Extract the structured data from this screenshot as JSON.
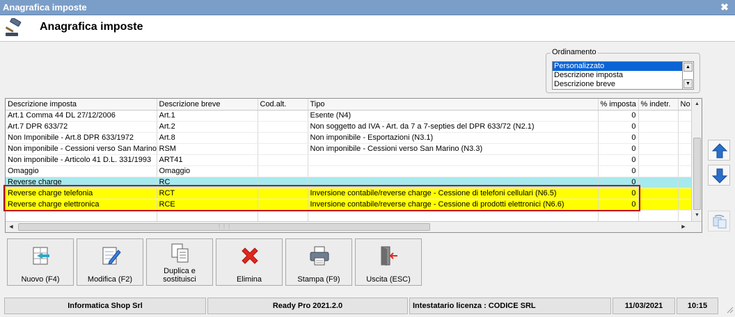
{
  "window": {
    "title": "Anagrafica imposte",
    "close_glyph": "✖"
  },
  "header": {
    "title": "Anagrafica imposte",
    "icon": "gavel-icon"
  },
  "ordinamento": {
    "label": "Ordinamento",
    "options": [
      "Personalizzato",
      "Descrizione imposta",
      "Descrizione breve"
    ],
    "selected": "Personalizzato"
  },
  "grid": {
    "columns": [
      "Descrizione imposta",
      "Descrizione breve",
      "Cod.alt.",
      "Tipo",
      "% imposta",
      "% indetr.",
      "No"
    ],
    "rows": [
      {
        "descrizione": "Art.1 Comma 44 DL 27/12/2006",
        "breve": "Art.1",
        "codalt": "",
        "tipo": "Esente (N4)",
        "imposta": "0",
        "indetr": ""
      },
      {
        "descrizione": "Art.7 DPR 633/72",
        "breve": "Art.2",
        "codalt": "",
        "tipo": "Non soggetto ad IVA - Art. da 7 a 7-septies del DPR 633/72 (N2.1)",
        "imposta": "0",
        "indetr": ""
      },
      {
        "descrizione": "Non Imponibile - Art.8 DPR 633/1972",
        "breve": "Art.8",
        "codalt": "",
        "tipo": "Non imponibile - Esportazioni (N3.1)",
        "imposta": "0",
        "indetr": ""
      },
      {
        "descrizione": "Non imponibile - Cessioni verso San Marino",
        "breve": "RSM",
        "codalt": "",
        "tipo": "Non imponibile - Cessioni verso San Marino (N3.3)",
        "imposta": "0",
        "indetr": ""
      },
      {
        "descrizione": "Non imponibile - Articolo 41 D.L. 331/1993",
        "breve": "ART41",
        "codalt": "",
        "tipo": "",
        "imposta": "0",
        "indetr": ""
      },
      {
        "descrizione": "Omaggio",
        "breve": "Omaggio",
        "codalt": "",
        "tipo": "",
        "imposta": "0",
        "indetr": ""
      },
      {
        "descrizione": "Reverse charge",
        "breve": "RC",
        "codalt": "",
        "tipo": "",
        "imposta": "0",
        "indetr": ""
      },
      {
        "descrizione": "Reverse charge telefonia",
        "breve": "RCT",
        "codalt": "",
        "tipo": "Inversione contabile/reverse charge - Cessione di telefoni cellulari (N6.5)",
        "imposta": "0",
        "indetr": ""
      },
      {
        "descrizione": "Reverse charge elettronica",
        "breve": "RCE",
        "codalt": "",
        "tipo": "Inversione contabile/reverse charge - Cessione di prodotti elettronici (N6.6)",
        "imposta": "0",
        "indetr": ""
      },
      {
        "descrizione": "",
        "breve": "",
        "codalt": "",
        "tipo": "",
        "imposta": "",
        "indetr": ""
      }
    ],
    "row_highlight": {
      "6": "#a6eaee",
      "7": "#ffff00",
      "8": "#ffff00"
    }
  },
  "side_buttons": [
    {
      "name": "move-up-button",
      "icon": "arrow-up-icon"
    },
    {
      "name": "move-down-button",
      "icon": "arrow-down-icon"
    },
    {
      "name": "refresh-button",
      "icon": "refresh-icon"
    }
  ],
  "toolbar": {
    "nuovo": "Nuovo (F4)",
    "modifica": "Modifica (F2)",
    "duplica_line1": "Duplica e",
    "duplica_line2": "sostituisci",
    "elimina": "Elimina",
    "stampa": "Stampa (F9)",
    "uscita": "Uscita (ESC)"
  },
  "status": {
    "company": "Informatica Shop Srl",
    "version": "Ready Pro 2021.2.0",
    "license": "Intestatario licenza : CODICE SRL",
    "date": "11/03/2021",
    "time": "10:15"
  },
  "colors": {
    "title_bar": "#7b9ec8",
    "selection": "#0a64d6",
    "highlight_cyan": "#a6eaee",
    "highlight_yellow": "#ffff00",
    "red_frame": "#c00000",
    "arrow_blue": "#2a6fc9"
  }
}
